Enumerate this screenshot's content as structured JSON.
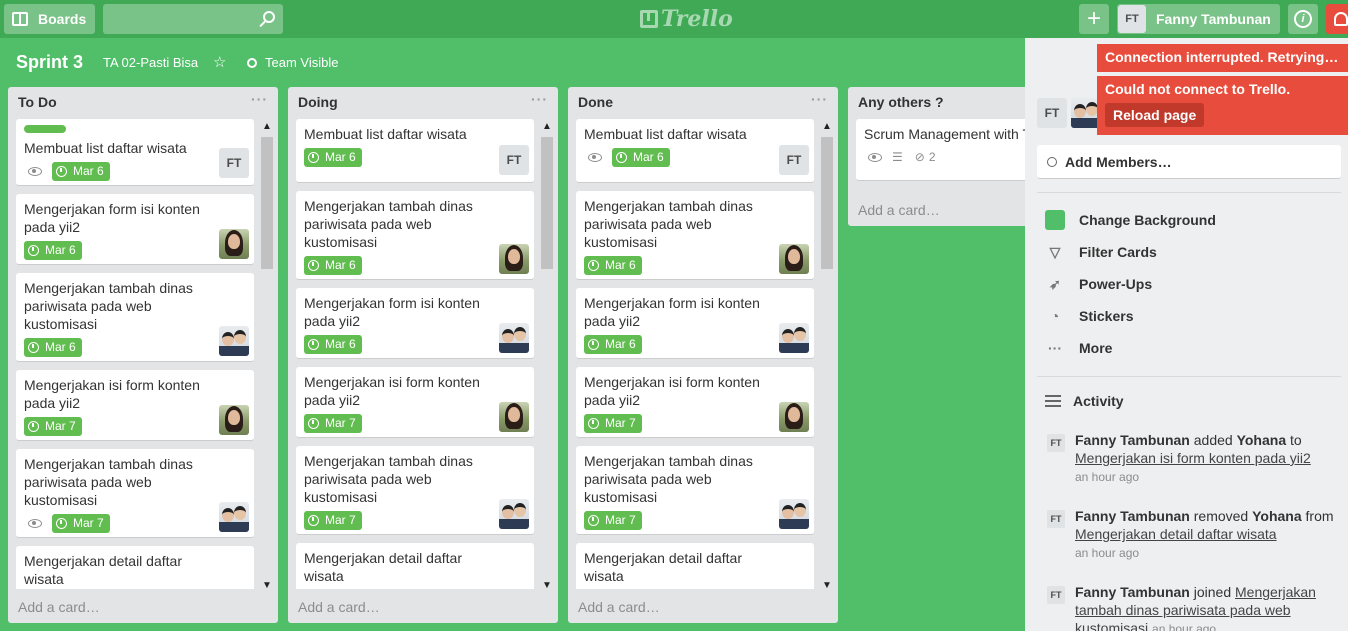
{
  "header": {
    "boards_label": "Boards",
    "search_placeholder": "",
    "logo_text": "Trello",
    "user_initials": "FT",
    "user_name": "Fanny Tambunan",
    "info_label": "i",
    "plus_label": "+"
  },
  "board": {
    "title": "Sprint 3",
    "team": "TA 02-Pasti Bisa",
    "star": "☆",
    "visibility": "Team Visible"
  },
  "lists": [
    {
      "name": "To Do",
      "menu": "···",
      "add_card": "Add a card…",
      "cards": [
        {
          "title": "Membuat list daftar wisata",
          "label": true,
          "eye": true,
          "due": "Mar 6",
          "member": "FT"
        },
        {
          "title": "Mengerjakan form isi konten pada yii2",
          "label": false,
          "eye": false,
          "due": "Mar 6",
          "member": "photo1"
        },
        {
          "title": "Mengerjakan tambah dinas pariwisata pada web kustomisasi",
          "label": false,
          "eye": false,
          "due": "Mar 6",
          "member": "photo2"
        },
        {
          "title": "Mengerjakan isi form konten pada yii2",
          "label": false,
          "eye": false,
          "due": "Mar 7",
          "member": "photo1"
        },
        {
          "title": "Mengerjakan tambah dinas pariwisata pada web kustomisasi",
          "label": false,
          "eye": true,
          "due": "Mar 7",
          "member": "photo2"
        },
        {
          "title": "Mengerjakan detail daftar wisata",
          "label": false,
          "eye": false,
          "due": "",
          "member": ""
        }
      ]
    },
    {
      "name": "Doing",
      "menu": "···",
      "add_card": "Add a card…",
      "cards": [
        {
          "title": "Membuat list daftar wisata",
          "due": "Mar 6",
          "member": "FT"
        },
        {
          "title": "Mengerjakan tambah dinas pariwisata pada web kustomisasi",
          "due": "Mar 6",
          "member": "photo1"
        },
        {
          "title": "Mengerjakan form isi konten pada yii2",
          "due": "Mar 6",
          "member": "photo2"
        },
        {
          "title": "Mengerjakan isi form konten pada yii2",
          "due": "Mar 7",
          "member": "photo1"
        },
        {
          "title": "Mengerjakan tambah dinas pariwisata pada web kustomisasi",
          "due": "Mar 7",
          "member": "photo2"
        },
        {
          "title": "Mengerjakan detail daftar wisata",
          "due": "",
          "member": ""
        }
      ]
    },
    {
      "name": "Done",
      "menu": "···",
      "add_card": "Add a card…",
      "cards": [
        {
          "title": "Membuat list daftar wisata",
          "eye": true,
          "due": "Mar 6",
          "member": "FT"
        },
        {
          "title": "Mengerjakan tambah dinas pariwisata pada web kustomisasi",
          "due": "Mar 6",
          "member": "photo1"
        },
        {
          "title": "Mengerjakan form isi konten pada yii2",
          "due": "Mar 6",
          "member": "photo2"
        },
        {
          "title": "Mengerjakan isi form konten pada yii2",
          "due": "Mar 7",
          "member": "photo1"
        },
        {
          "title": "Mengerjakan tambah dinas pariwisata pada web kustomisasi",
          "due": "Mar 7",
          "member": "photo2"
        },
        {
          "title": "Mengerjakan detail daftar wisata",
          "due": "",
          "member": ""
        }
      ]
    },
    {
      "name": "Any others ?",
      "add_card": "Add a card…",
      "cards": [
        {
          "title": "Scrum Management with T",
          "attachments": "2"
        }
      ]
    }
  ],
  "sidebar": {
    "member_initials": "FT",
    "add_members": "Add Members…",
    "menu": [
      {
        "label": "Change Background",
        "icon": "swatch"
      },
      {
        "label": "Filter Cards",
        "icon": "filter-icon"
      },
      {
        "label": "Power-Ups",
        "icon": "rocket-icon"
      },
      {
        "label": "Stickers",
        "icon": "sticker-icon"
      },
      {
        "label": "More",
        "icon": "more-icon"
      }
    ],
    "activity_title": "Activity",
    "activity": [
      {
        "initials": "FT",
        "user": "Fanny Tambunan",
        "action": "added",
        "target_user": "Yohana",
        "prep": "to",
        "card": "Mengerjakan isi form konten pada yii2",
        "time": "an hour ago"
      },
      {
        "initials": "FT",
        "user": "Fanny Tambunan",
        "action": "removed",
        "target_user": "Yohana",
        "prep": "from",
        "card": "Mengerjakan detail daftar wisata",
        "time": "an hour ago"
      },
      {
        "initials": "FT",
        "user": "Fanny Tambunan",
        "action": "joined",
        "card": "Mengerjakan tambah dinas pariwisata pada web kustomisasi",
        "time": "an hour ago"
      }
    ]
  },
  "alerts": {
    "connection": "Connection interrupted. Retrying…",
    "could_not_connect": "Could not connect to Trello.",
    "reload": "Reload page"
  },
  "colors": {
    "board_bg": "#51bf6a",
    "header_bg": "#3fa955",
    "due_green": "#61bd4f",
    "alert_red": "#e74c3c"
  }
}
